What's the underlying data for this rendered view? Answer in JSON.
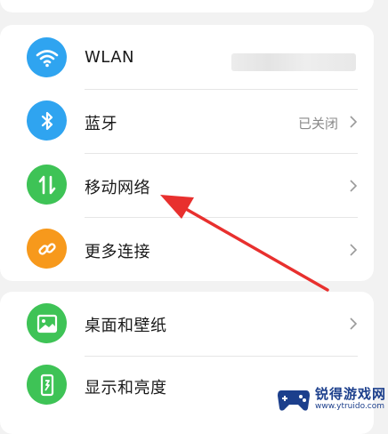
{
  "settings": {
    "items": [
      {
        "name": "wlan",
        "label": "WLAN",
        "status": "",
        "icon": "wifi-icon",
        "color": "#2fa4f0"
      },
      {
        "name": "bluetooth",
        "label": "蓝牙",
        "status": "已关闭",
        "icon": "bluetooth-icon",
        "color": "#2fa4f0"
      },
      {
        "name": "mobile-network",
        "label": "移动网络",
        "status": "",
        "icon": "mobile-data-icon",
        "color": "#3ec356"
      },
      {
        "name": "more-connections",
        "label": "更多连接",
        "status": "",
        "icon": "link-icon",
        "color": "#f7991c"
      },
      {
        "name": "desktop-wallpaper",
        "label": "桌面和壁纸",
        "status": "",
        "icon": "image-icon",
        "color": "#3ec356"
      },
      {
        "name": "display-brightness",
        "label": "显示和亮度",
        "status": "",
        "icon": "phone-brightness-icon",
        "color": "#3ec356"
      }
    ]
  },
  "annotation": {
    "type": "red-arrow",
    "color": "#e8302e",
    "points_to": "移动网络"
  },
  "watermark": {
    "brand": "锐得游戏网",
    "url": "www.ytruido.com",
    "logo_color": "#1c3f8c"
  }
}
